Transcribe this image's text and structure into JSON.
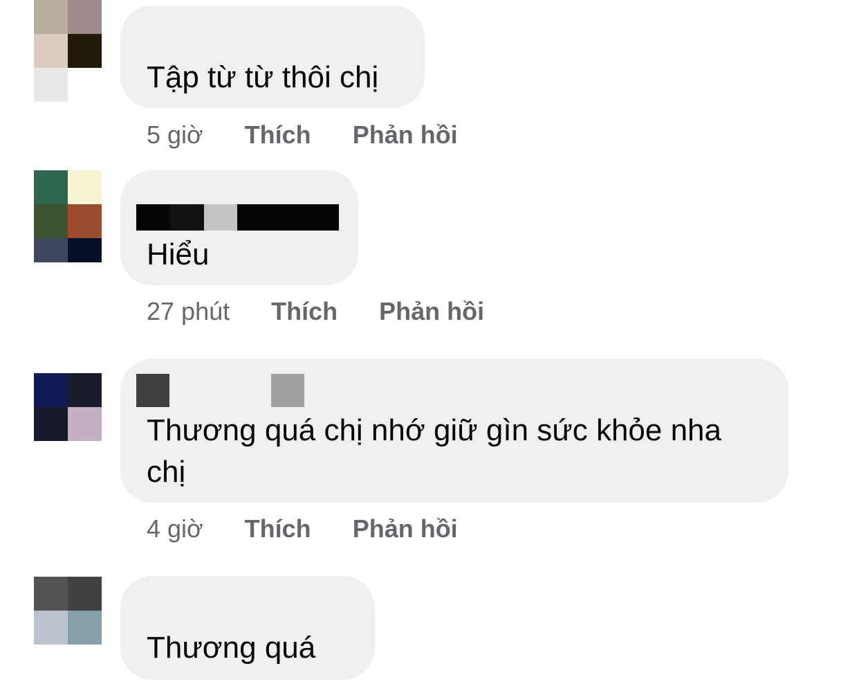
{
  "comments": [
    {
      "text": "Tập từ từ thôi chị",
      "time": "5 giờ",
      "like": "Thích",
      "reply": "Phản hồi"
    },
    {
      "text": "Hiểu",
      "time": "27 phút",
      "like": "Thích",
      "reply": "Phản hồi"
    },
    {
      "text_line1": "Thương quá chị nhớ giữ gìn sức khỏe nha",
      "text_line2": "chị",
      "time": "4 giờ",
      "like": "Thích",
      "reply": "Phản hồi"
    },
    {
      "text": "Thương quá"
    }
  ],
  "colors": {
    "bubble": "#f0f0f2",
    "meta_text": "#65676b",
    "comment_text": "#050505"
  }
}
